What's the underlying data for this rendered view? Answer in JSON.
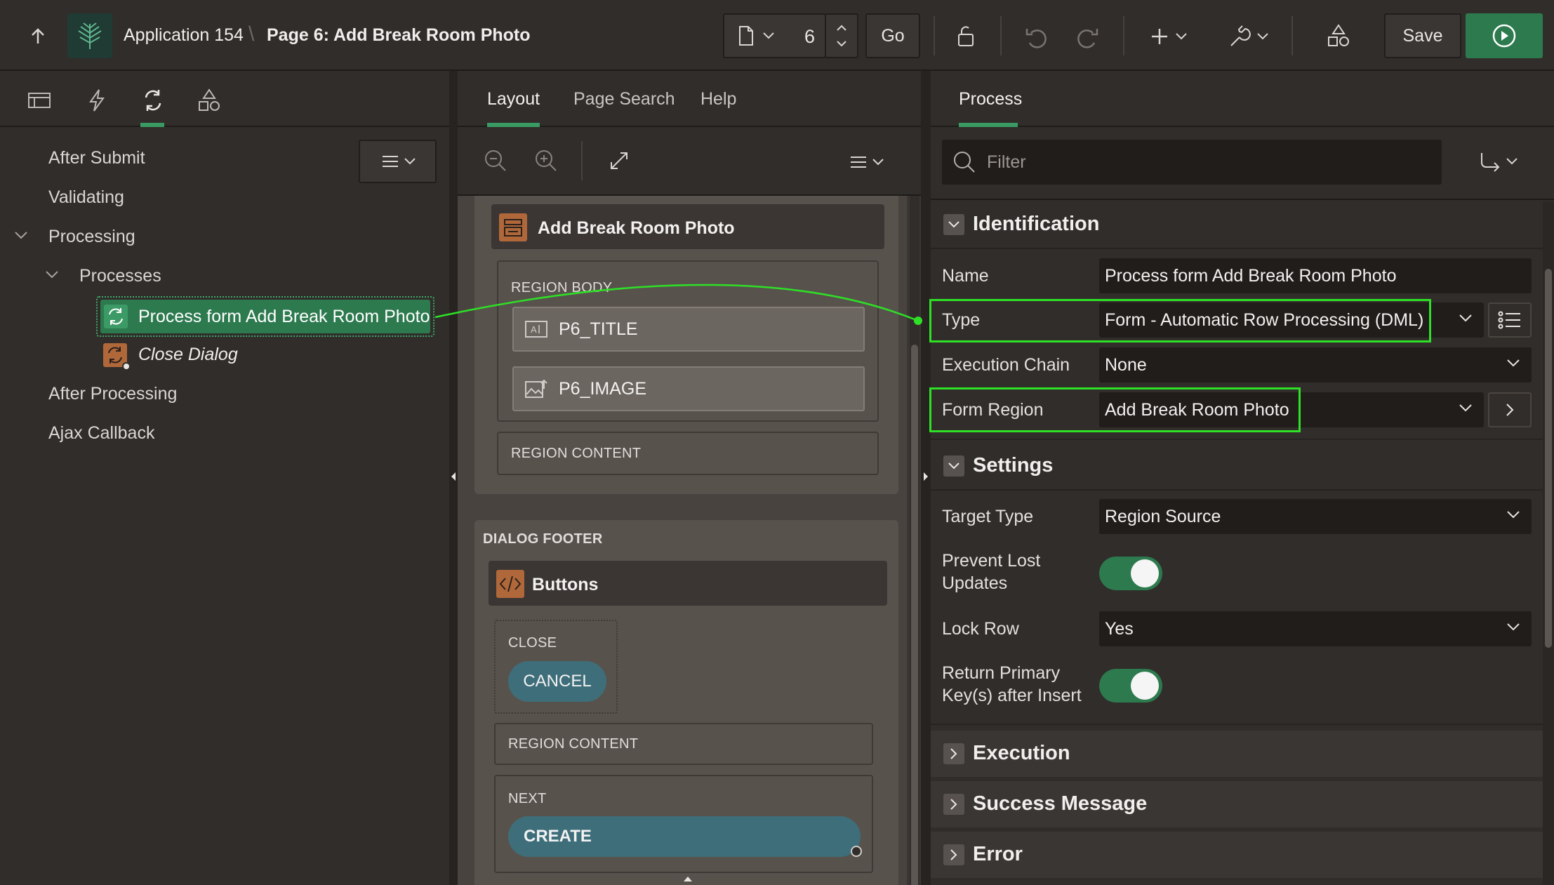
{
  "header": {
    "app_name": "Application 154",
    "page_title": "Page 6: Add Break Room Photo",
    "page_number": "6",
    "go_label": "Go",
    "save_label": "Save"
  },
  "left_panel": {
    "tree": {
      "after_submit": "After Submit",
      "validating": "Validating",
      "processing": "Processing",
      "processes": "Processes",
      "process_item": "Process form Add Break Room Photo",
      "close_dialog": "Close Dialog",
      "after_processing": "After Processing",
      "ajax_callback": "Ajax Callback"
    }
  },
  "middle_panel": {
    "tabs": [
      "Layout",
      "Page Search",
      "Help"
    ],
    "region_title": "Add Break Room Photo",
    "region_body_label": "REGION BODY",
    "items": [
      "P6_TITLE",
      "P6_IMAGE"
    ],
    "region_content_label": "REGION CONTENT",
    "dialog_footer_label": "DIALOG FOOTER",
    "buttons_region_title": "Buttons",
    "close_label": "CLOSE",
    "cancel_button": "CANCEL",
    "footer_region_content_label": "REGION CONTENT",
    "next_label": "NEXT",
    "create_button": "CREATE"
  },
  "right_panel": {
    "tab": "Process",
    "filter_placeholder": "Filter",
    "identification": {
      "title": "Identification",
      "name_label": "Name",
      "name_value": "Process form Add Break Room Photo",
      "type_label": "Type",
      "type_value": "Form - Automatic Row Processing (DML)",
      "execution_chain_label": "Execution Chain",
      "execution_chain_value": "None",
      "form_region_label": "Form Region",
      "form_region_value": "Add Break Room Photo"
    },
    "settings": {
      "title": "Settings",
      "target_type_label": "Target Type",
      "target_type_value": "Region Source",
      "prevent_lost_updates_label": "Prevent Lost Updates",
      "prevent_lost_updates_value": true,
      "lock_row_label": "Lock Row",
      "lock_row_value": "Yes",
      "return_pk_label": "Return Primary Key(s) after Insert",
      "return_pk_value": true
    },
    "collapsed_sections": [
      "Execution",
      "Success Message",
      "Error"
    ]
  },
  "colors": {
    "accent_green": "#2d7a4f",
    "highlight": "#2ee026",
    "button_teal": "#3e6e7a",
    "region_icon_orange": "#b0683a"
  }
}
